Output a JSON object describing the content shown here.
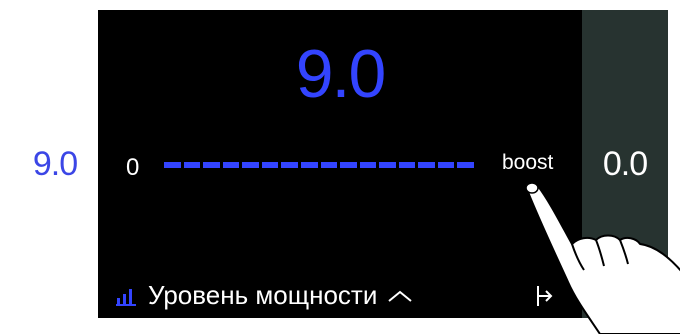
{
  "left_zone": {
    "value": "9.0"
  },
  "active_zone": {
    "value": "9.0",
    "scale_min": "0",
    "boost_label": "boost",
    "power_level": 0.9,
    "segments": 16
  },
  "right_zone": {
    "value": "0.0"
  },
  "bottom_bar": {
    "label": "Уровень мощности",
    "bars_icon": "power-level-bars-icon",
    "chevron_icon": "chevron-up-icon",
    "timer_icon": "timer-icon"
  },
  "colors": {
    "accent": "#3344ff",
    "background": "#000000",
    "right_panel": "#273330",
    "left_panel": "#ffffff"
  }
}
